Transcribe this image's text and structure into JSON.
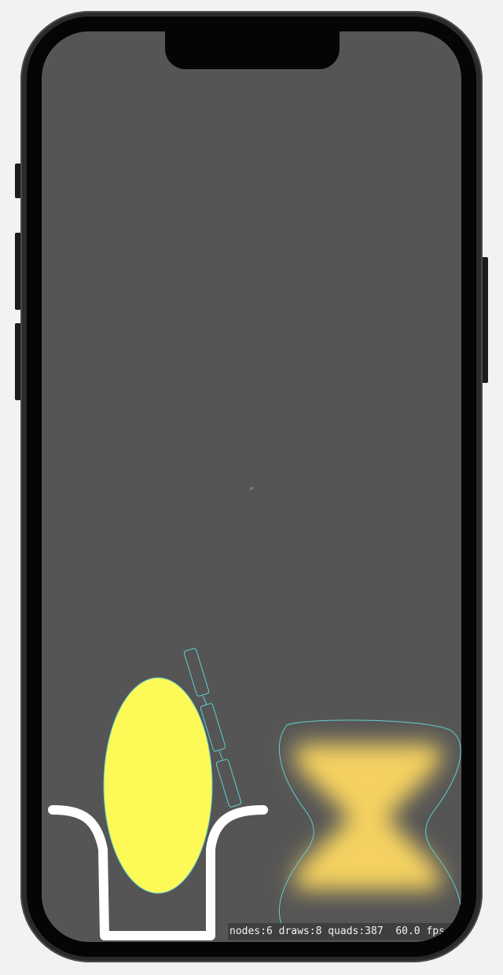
{
  "device": {
    "model": "iphone"
  },
  "colors": {
    "screen_background": "#555555",
    "ellipse_fill": "#fdfa57",
    "outline_cyan": "#5fd0d0",
    "glow_yellow": "#f4d160",
    "bucket_white": "#ffffff",
    "stats_background": "#3f3f3f",
    "stats_text": "#f2f2f2"
  },
  "scene": {
    "nodes": [
      {
        "name": "yellow-ellipse-body",
        "shape": "ellipse"
      },
      {
        "name": "chain-link",
        "shape": "rounded-rect"
      },
      {
        "name": "chain-link",
        "shape": "rounded-rect"
      },
      {
        "name": "chain-link",
        "shape": "rounded-rect"
      },
      {
        "name": "bucket-edge",
        "shape": "path"
      },
      {
        "name": "glowing-hourglass",
        "shape": "path"
      }
    ]
  },
  "stats": {
    "text": "nodes:6 draws:8 quads:387  60.0 fps"
  }
}
